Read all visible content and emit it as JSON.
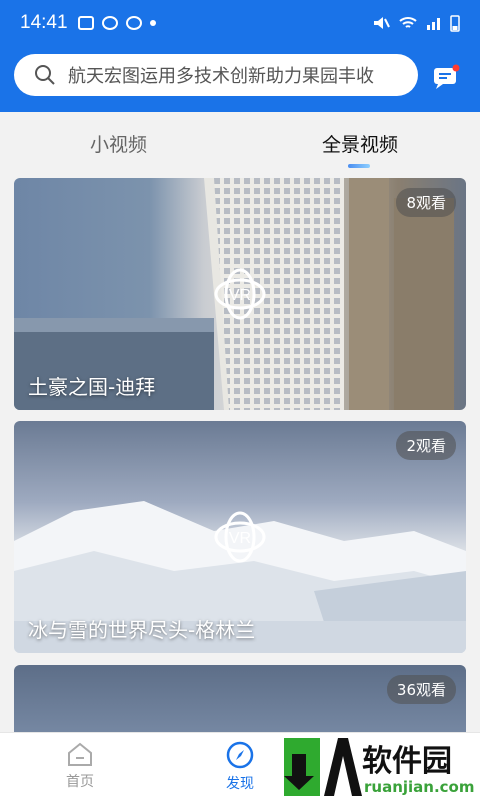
{
  "status_bar": {
    "time": "14:41"
  },
  "search": {
    "placeholder": "航天宏图运用多技术创新助力果园丰收"
  },
  "tabs": [
    {
      "label": "小视频",
      "active": false
    },
    {
      "label": "全景视频",
      "active": true
    }
  ],
  "cards": [
    {
      "title": "土豪之国-迪拜",
      "views": "8观看",
      "badge": "VR"
    },
    {
      "title": "冰与雪的世界尽头-格林兰",
      "views": "2观看",
      "badge": "VR"
    },
    {
      "title": "",
      "views": "36观看",
      "badge": ""
    }
  ],
  "tabbar": {
    "home": "首页",
    "discover": "发现"
  },
  "watermark": {
    "zh": "软件园",
    "en": "ruanjian.com"
  },
  "colors": {
    "primary": "#1a73e8",
    "badge_bg": "#555555"
  }
}
